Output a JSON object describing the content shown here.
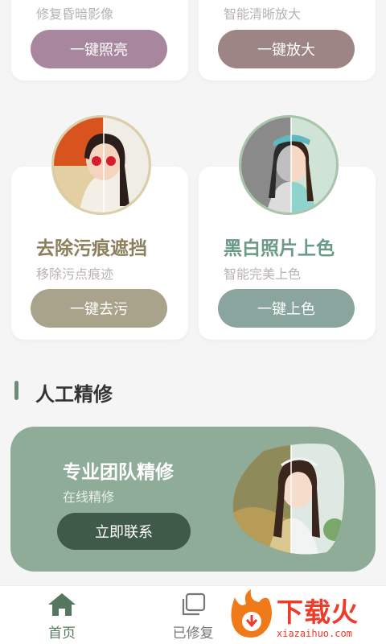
{
  "features": [
    {
      "subtitle": "修复昏暗影像",
      "button": "一键照亮",
      "button_color": "#a8869e"
    },
    {
      "subtitle": "智能清晰放大",
      "button": "一键放大",
      "button_color": "#9d8585"
    },
    {
      "title": "去除污痕遮挡",
      "subtitle": "移除污点痕迹",
      "button": "一键去污",
      "title_color": "#8c7f5c",
      "button_color": "#a8a38a"
    },
    {
      "title": "黑白照片上色",
      "subtitle": "智能完美上色",
      "button": "一键上色",
      "title_color": "#6a9a86",
      "button_color": "#8aa59d"
    }
  ],
  "section": {
    "title": "人工精修"
  },
  "banner": {
    "title": "专业团队精修",
    "subtitle": "在线精修",
    "button": "立即联系",
    "background": "#8fac98"
  },
  "tabbar": {
    "home": {
      "label": "首页",
      "icon": "home-icon",
      "color": "#55775f"
    },
    "fixed": {
      "label": "已修复",
      "icon": "layers-icon",
      "color": "#777777"
    }
  },
  "watermark": {
    "text": "下载火",
    "url": "xiazaihuo.com"
  }
}
